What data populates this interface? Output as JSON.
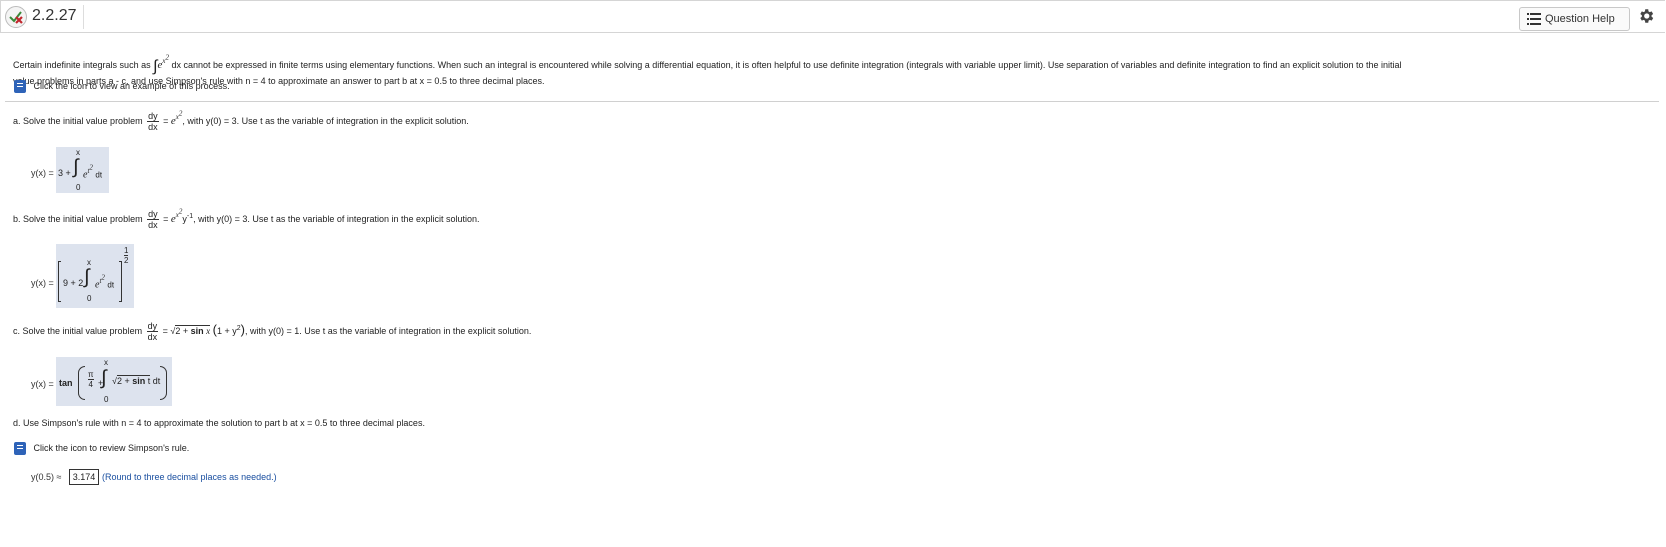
{
  "header": {
    "question_number": "2.2.27",
    "help_label": "Question Help"
  },
  "intro": {
    "text_before": "Certain indefinite integrals such as",
    "text_after": "dx cannot be expressed in finite terms using elementary functions. When such an integral is encountered while solving a differential equation, it is often helpful to use definite integration (integrals with variable upper limit). Use separation of variables and definite integration to find an explicit solution to the initial",
    "line2": "value problems in parts a - c, and use Simpson's rule with n = 4 to approximate an answer to part b at x = 0.5 to three decimal places.",
    "example_link": "Click the icon to view an example of this process."
  },
  "part_a": {
    "prefix": "a. Solve the initial value problem",
    "suffix": ", with y(0) = 3. Use t as the variable of integration in the explicit solution.",
    "answer_label": "y(x) =",
    "answer_const": "3 +",
    "lower": "0",
    "upper": "x"
  },
  "part_b": {
    "prefix": "b. Solve the initial value problem",
    "suffix": ", with y(0) = 3. Use t as the variable of integration in the explicit solution.",
    "answer_label": "y(x) =",
    "answer_const": "9 + 2",
    "lower": "0",
    "upper": "x",
    "exponent_num": "1",
    "exponent_den": "2"
  },
  "part_c": {
    "prefix": "c. Solve the initial value problem",
    "suffix": ", with y(0) = 1. Use t as the variable of integration in the explicit solution.",
    "answer_label": "y(x) =",
    "answer_func": "tan",
    "pi_num": "π",
    "pi_den": "4",
    "lower": "0",
    "upper": "x"
  },
  "part_d": {
    "prefix": "d. Use Simpson's rule with n = 4 to approximate the solution to part b at x = 0.5 to three decimal places.",
    "review_link": "Click the icon to review Simpson's rule.",
    "answer_label": "y(0.5) ≈",
    "answer_value": "3.174",
    "hint": "(Round to three decimal places as needed.)"
  },
  "colors": {
    "answer_bg": "#dde3ee",
    "hint": "#1a4fa0",
    "book_icon": "#2e63b8"
  },
  "icons": [
    "status-x-icon",
    "list-icon",
    "gear-icon",
    "book-icon"
  ]
}
